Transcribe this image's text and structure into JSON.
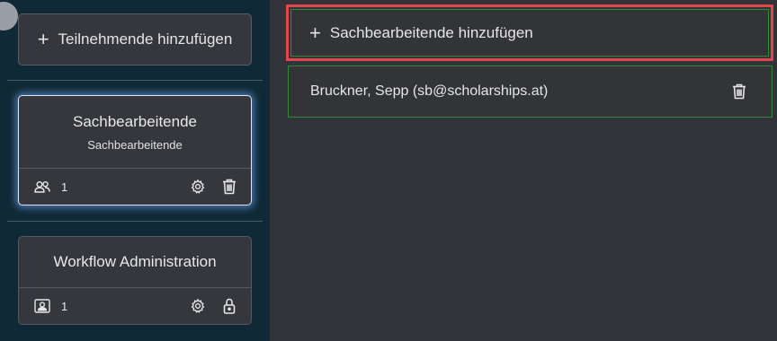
{
  "sidebar": {
    "add_participants_label": "Teilnehmende hinzufügen",
    "cards": [
      {
        "title": "Sachbearbeitende",
        "subtitle": "Sachbearbeitende",
        "member_count": "1",
        "count_icon": "users-icon",
        "actions": [
          "gear-icon",
          "trash-icon"
        ],
        "selected": true
      },
      {
        "title": "Workflow Administration",
        "member_count": "1",
        "count_icon": "contact-card-icon",
        "actions": [
          "gear-icon",
          "lock-icon"
        ],
        "selected": false
      }
    ]
  },
  "main": {
    "add_case_workers_label": "Sachbearbeitende hinzufügen",
    "members": [
      {
        "name": "Bruckner, Sepp (sb@scholarships.at)",
        "action": "trash-icon"
      }
    ]
  },
  "colors": {
    "sidebar_bg": "#0f2a36",
    "main_bg": "#313338",
    "card_bg": "#35373c",
    "highlight_border": "#e0464a",
    "row_border": "#2f8a3a",
    "selected_glow": "#78aaff"
  }
}
